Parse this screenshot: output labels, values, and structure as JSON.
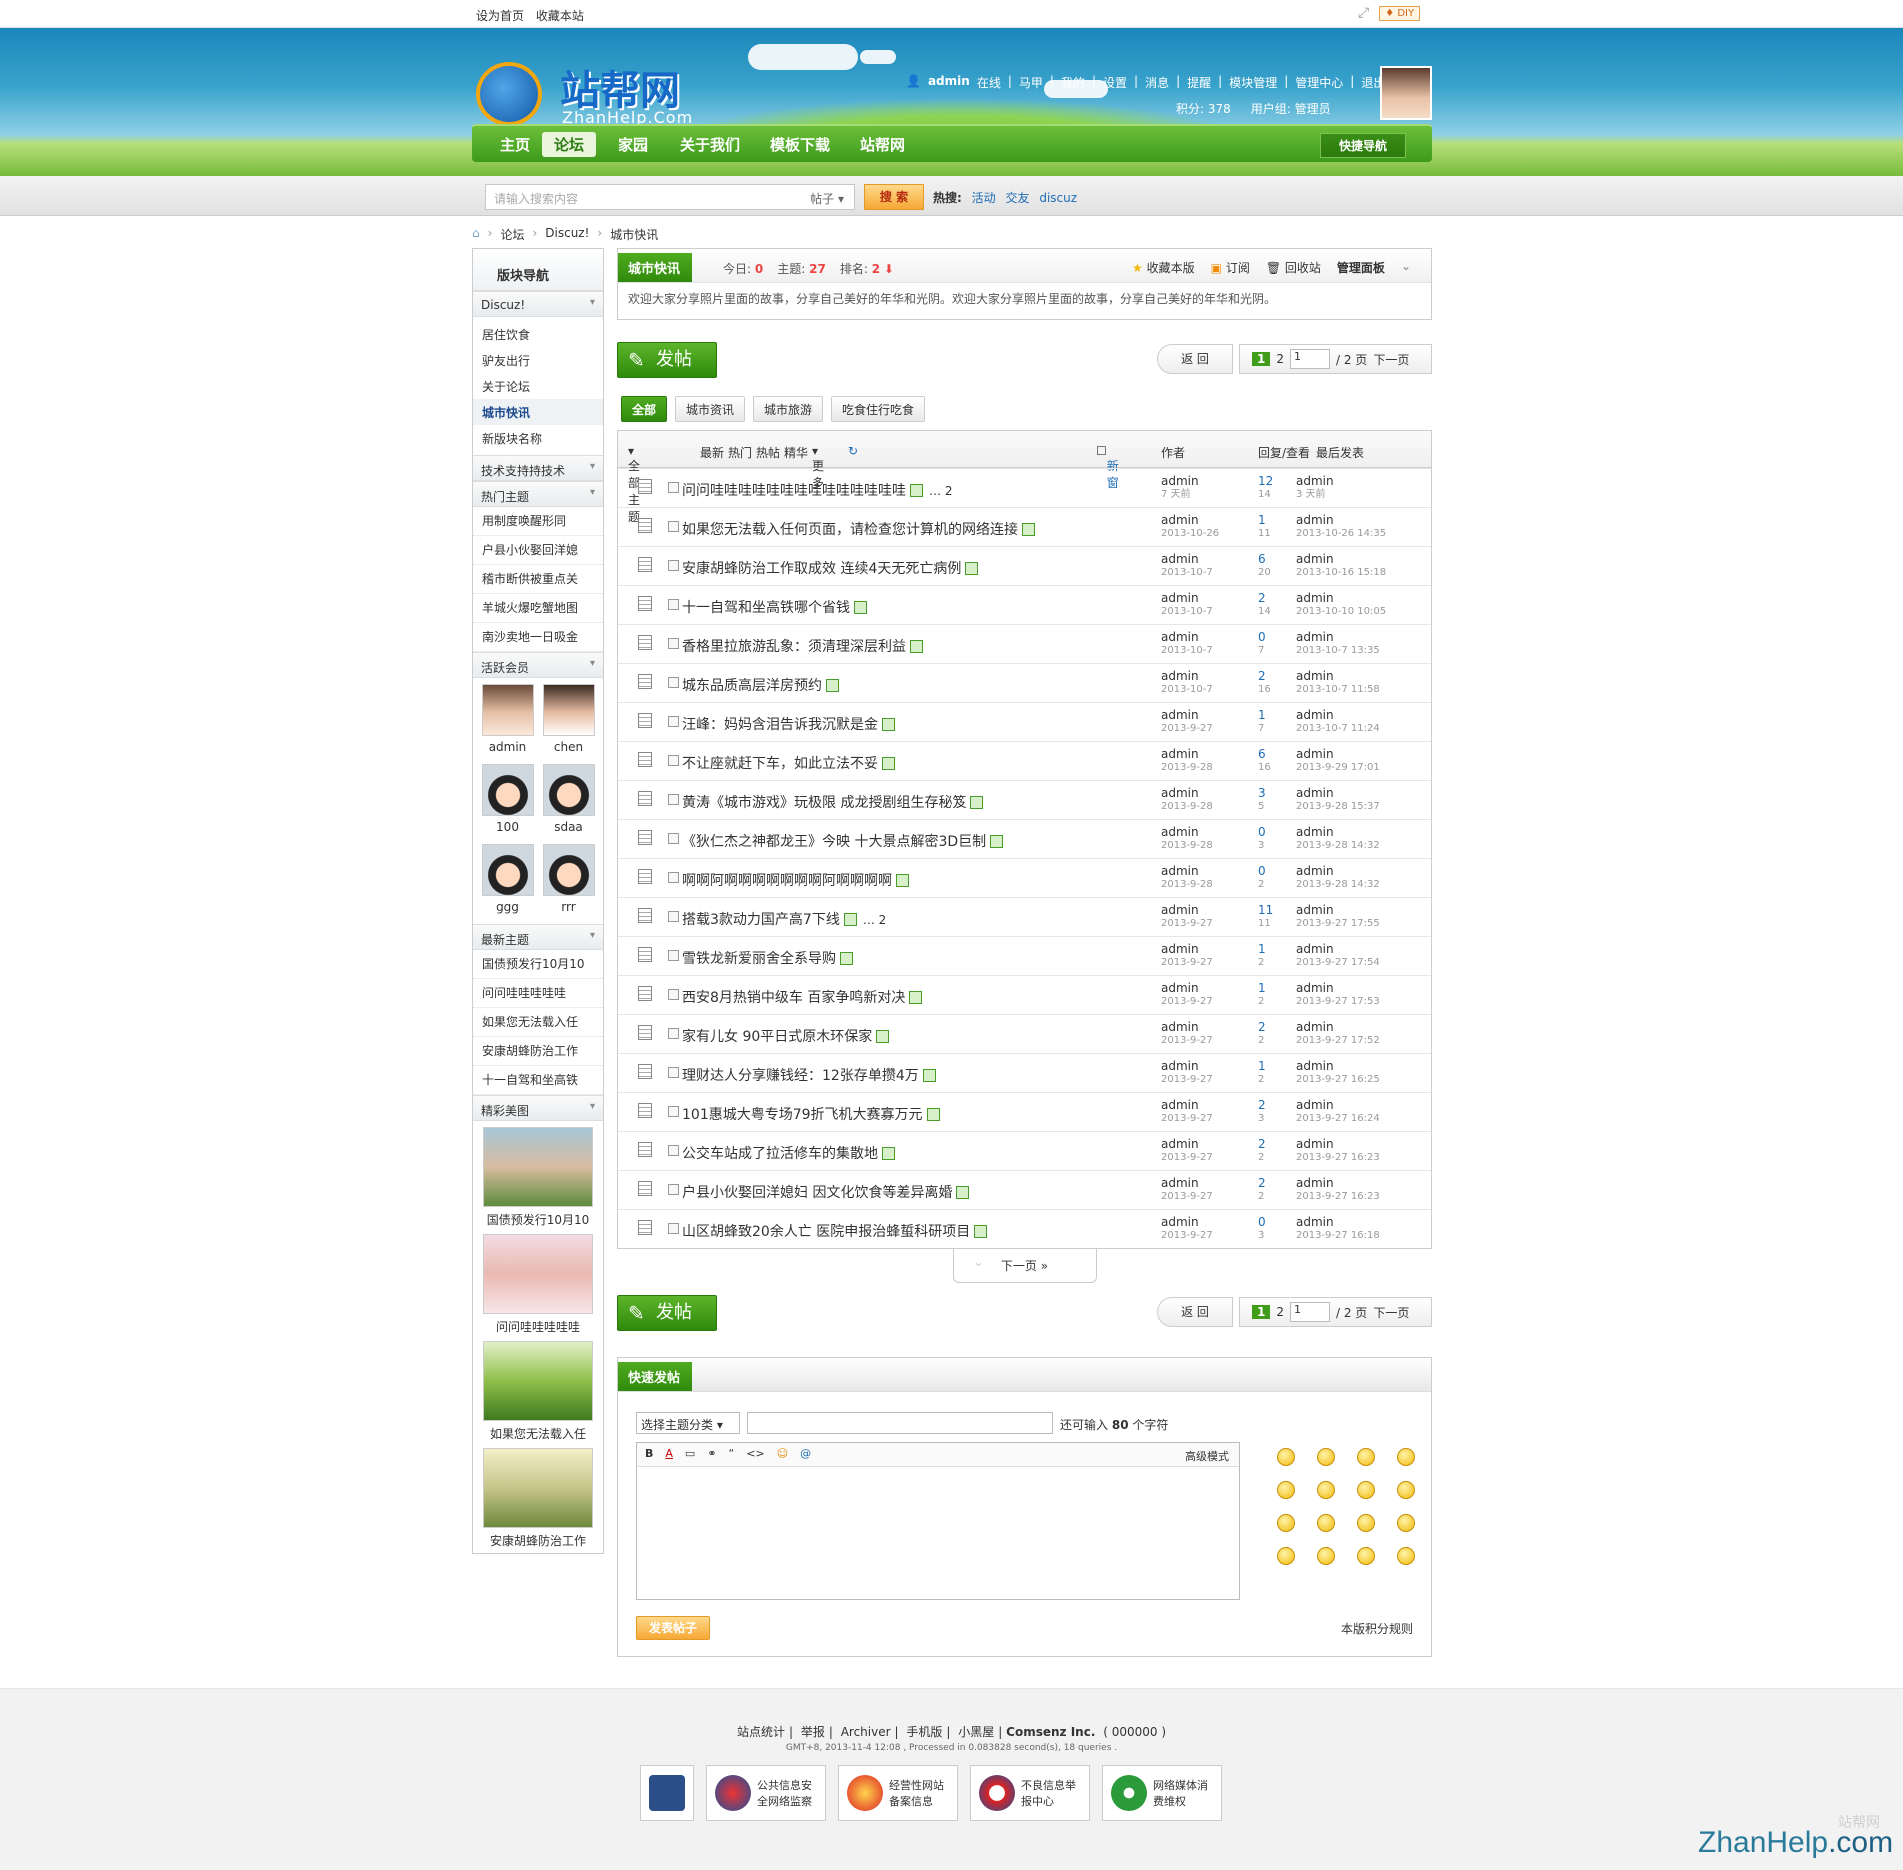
{
  "topbar": {
    "set_home": "设为首页",
    "bookmark": "收藏本站",
    "diy": "♦ DIY"
  },
  "logo": {
    "title": "站帮网",
    "sub": "ZhanHelp.Com"
  },
  "user": {
    "name": "admin",
    "online": "在线",
    "items": [
      "马甲",
      "我的",
      "设置",
      "消息",
      "提醒",
      "模块管理",
      "管理中心",
      "退出"
    ],
    "points": "积分: 378",
    "group": "用户组: 管理员"
  },
  "nav": {
    "items": [
      "主页",
      "论坛",
      "家园",
      "关于我们",
      "模板下载",
      "站帮网"
    ],
    "quick": "快捷导航"
  },
  "search": {
    "placeholder": "请输入搜索内容",
    "type": "帖子",
    "button": "搜 索",
    "hot_label": "热搜:",
    "hot": [
      "活动",
      "交友",
      "discuz"
    ]
  },
  "crumb": [
    "论坛",
    "Discuz!",
    "城市快讯"
  ],
  "side": {
    "title": "版块导航",
    "sec_discuz": "Discuz!",
    "forums": [
      "居住饮食",
      "驴友出行",
      "关于论坛",
      "城市快讯",
      "新版块名称"
    ],
    "sec_tech": "技术支持持技术",
    "sec_hot": "热门主题",
    "hot": [
      "用制度唤醒形同",
      "户县小伙娶回洋媳",
      "稽市断供被重点关",
      "羊城火爆吃蟹地图",
      "南沙卖地一日吸金"
    ],
    "sec_members": "活跃会员",
    "members": [
      "admin",
      "chen",
      "100",
      "sdaa",
      "ggg",
      "rrr"
    ],
    "sec_new": "最新主题",
    "new": [
      "国债预发行10月10",
      "问问哇哇哇哇哇",
      "如果您无法载入任",
      "安康胡蜂防治工作",
      "十一自驾和坐高铁"
    ],
    "sec_pics": "精彩美图",
    "pics": [
      "国债预发行10月10",
      "问问哇哇哇哇哇",
      "如果您无法载入任",
      "安康胡蜂防治工作"
    ]
  },
  "forum": {
    "name": "城市快讯",
    "today_label": "今日:",
    "today": "0",
    "topics_label": "主题:",
    "topics": "27",
    "rank_label": "排名:",
    "rank": "2",
    "tools": [
      "收藏本版",
      "订阅",
      "回收站",
      "管理面板"
    ],
    "desc": "欢迎大家分享照片里面的故事，分享自己美好的年华和光阴。欢迎大家分享照片里面的故事，分享自己美好的年华和光阴。"
  },
  "pager": {
    "post": "发帖",
    "back": "返 回",
    "cur": "1",
    "p2": "2",
    "input": "1",
    "total": "/ 2 页",
    "next": "下一页"
  },
  "filters": [
    "全部",
    "城市资讯",
    "城市旅游",
    "吃食住行吃食"
  ],
  "thead": {
    "all": "全部主题",
    "latest": "最新",
    "hot": "热门",
    "hotpost": "热帖",
    "digest": "精华",
    "more": "更多",
    "new": "新窗",
    "author": "作者",
    "reply": "回复/查看",
    "last": "最后发表"
  },
  "threads": [
    {
      "t": "问问哇哇哇哇哇哇哇哇哇哇哇哇哇哇",
      "p": "… 2",
      "a": "admin",
      "ad": "7 天前",
      "r": "12",
      "v": "14",
      "l": "admin",
      "ld": "3 天前"
    },
    {
      "t": "如果您无法载入任何页面，请检查您计算机的网络连接",
      "p": "",
      "a": "admin",
      "ad": "2013-10-26",
      "r": "1",
      "v": "11",
      "l": "admin",
      "ld": "2013-10-26 14:35"
    },
    {
      "t": "安康胡蜂防治工作取成效 连续4天无死亡病例",
      "p": "",
      "a": "admin",
      "ad": "2013-10-7",
      "r": "6",
      "v": "20",
      "l": "admin",
      "ld": "2013-10-16 15:18"
    },
    {
      "t": "十一自驾和坐高铁哪个省钱",
      "p": "",
      "a": "admin",
      "ad": "2013-10-7",
      "r": "2",
      "v": "14",
      "l": "admin",
      "ld": "2013-10-10 10:05"
    },
    {
      "t": "香格里拉旅游乱象：须清理深层利益",
      "p": "",
      "a": "admin",
      "ad": "2013-10-7",
      "r": "0",
      "v": "7",
      "l": "admin",
      "ld": "2013-10-7 13:35"
    },
    {
      "t": "城东品质高层洋房预约",
      "p": "",
      "a": "admin",
      "ad": "2013-10-7",
      "r": "2",
      "v": "16",
      "l": "admin",
      "ld": "2013-10-7 11:58"
    },
    {
      "t": "汪峰：妈妈含泪告诉我沉默是金",
      "p": "",
      "a": "admin",
      "ad": "2013-9-27",
      "r": "1",
      "v": "7",
      "l": "admin",
      "ld": "2013-10-7 11:24"
    },
    {
      "t": "不让座就赶下车，如此立法不妥",
      "p": "",
      "a": "admin",
      "ad": "2013-9-28",
      "r": "6",
      "v": "16",
      "l": "admin",
      "ld": "2013-9-29 17:01"
    },
    {
      "t": "黄涛《城市游戏》玩极限 成龙授剧组生存秘笈",
      "p": "",
      "a": "admin",
      "ad": "2013-9-28",
      "r": "3",
      "v": "5",
      "l": "admin",
      "ld": "2013-9-28 15:37"
    },
    {
      "t": "《狄仁杰之神都龙王》今映 十大景点解密3D巨制",
      "p": "",
      "a": "admin",
      "ad": "2013-9-28",
      "r": "0",
      "v": "3",
      "l": "admin",
      "ld": "2013-9-28 14:32"
    },
    {
      "t": "啊啊阿啊啊啊啊啊啊啊阿啊啊啊啊",
      "p": "",
      "a": "admin",
      "ad": "2013-9-28",
      "r": "0",
      "v": "2",
      "l": "admin",
      "ld": "2013-9-28 14:32"
    },
    {
      "t": "搭载3款动力国产高7下线",
      "p": "… 2",
      "a": "admin",
      "ad": "2013-9-27",
      "r": "11",
      "v": "11",
      "l": "admin",
      "ld": "2013-9-27 17:55"
    },
    {
      "t": "雪铁龙新爱丽舍全系导购",
      "p": "",
      "a": "admin",
      "ad": "2013-9-27",
      "r": "1",
      "v": "2",
      "l": "admin",
      "ld": "2013-9-27 17:54"
    },
    {
      "t": "西安8月热销中级车 百家争鸣新对决",
      "p": "",
      "a": "admin",
      "ad": "2013-9-27",
      "r": "1",
      "v": "2",
      "l": "admin",
      "ld": "2013-9-27 17:53"
    },
    {
      "t": "家有儿女 90平日式原木环保家",
      "p": "",
      "a": "admin",
      "ad": "2013-9-27",
      "r": "2",
      "v": "2",
      "l": "admin",
      "ld": "2013-9-27 17:52"
    },
    {
      "t": "理财达人分享赚钱经：12张存单攒4万",
      "p": "",
      "a": "admin",
      "ad": "2013-9-27",
      "r": "1",
      "v": "2",
      "l": "admin",
      "ld": "2013-9-27 16:25"
    },
    {
      "t": "101惠城大粤专场79折飞机大赛寡万元",
      "p": "",
      "a": "admin",
      "ad": "2013-9-27",
      "r": "2",
      "v": "3",
      "l": "admin",
      "ld": "2013-9-27 16:24"
    },
    {
      "t": "公交车站成了拉活修车的集散地",
      "p": "",
      "a": "admin",
      "ad": "2013-9-27",
      "r": "2",
      "v": "2",
      "l": "admin",
      "ld": "2013-9-27 16:23"
    },
    {
      "t": "户县小伙娶回洋媳妇 因文化饮食等差异离婚",
      "p": "",
      "a": "admin",
      "ad": "2013-9-27",
      "r": "2",
      "v": "2",
      "l": "admin",
      "ld": "2013-9-27 16:23"
    },
    {
      "t": "山区胡蜂致20余人亡 医院申报治蜂蜇科研项目",
      "p": "",
      "a": "admin",
      "ad": "2013-9-27",
      "r": "0",
      "v": "3",
      "l": "admin",
      "ld": "2013-9-27 16:18"
    }
  ],
  "next_page": "下一页 »",
  "quickpost": {
    "title": "快速发帖",
    "select": "选择主题分类",
    "limit_pre": "还可输入",
    "limit": "80",
    "limit_post": "个字符",
    "advanced": "高级模式",
    "submit": "发表帖子",
    "rules": "本版积分规则",
    "toolbar": [
      "B",
      "A",
      "▭",
      "⚭",
      "“",
      "<>",
      "☺",
      "@"
    ]
  },
  "footer": {
    "links": [
      "站点统计",
      "举报",
      "Archiver",
      "手机版",
      "小黑屋",
      "Comsenz Inc.",
      "( 000000 )"
    ],
    "info": "GMT+8, 2013-11-4 12:08 , Processed in 0.083828 second(s), 18 queries .",
    "badges": [
      "公共信息安全网络监察",
      "经营性网站备案信息",
      "不良信息举报中心",
      "网络媒体消费维权"
    ]
  },
  "watermark": {
    "main": "ZhanHelp",
    "suffix": ".com",
    "cn": "站帮网"
  },
  "colors": {
    "green": "#3f9d19",
    "blue": "#1d6db5",
    "red": "#e44444",
    "orange": "#f6a834"
  }
}
